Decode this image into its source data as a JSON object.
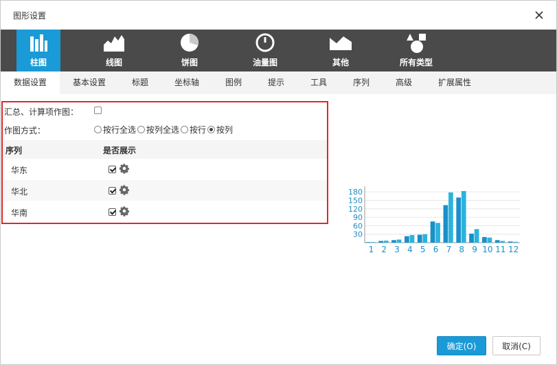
{
  "dialog": {
    "title": "图形设置",
    "close_icon": "close-icon"
  },
  "chart_types": [
    {
      "label": "柱图",
      "icon": "bar-chart-icon",
      "active": true
    },
    {
      "label": "线图",
      "icon": "line-chart-icon",
      "active": false
    },
    {
      "label": "饼图",
      "icon": "pie-chart-icon",
      "active": false
    },
    {
      "label": "油量图",
      "icon": "gauge-icon",
      "active": false
    },
    {
      "label": "其他",
      "icon": "other-chart-icon",
      "active": false
    },
    {
      "label": "所有类型",
      "icon": "all-types-icon",
      "active": false
    }
  ],
  "tabs": [
    {
      "label": "数据设置",
      "active": true
    },
    {
      "label": "基本设置"
    },
    {
      "label": "标题"
    },
    {
      "label": "坐标轴"
    },
    {
      "label": "图例"
    },
    {
      "label": "提示"
    },
    {
      "label": "工具"
    },
    {
      "label": "序列"
    },
    {
      "label": "高级"
    },
    {
      "label": "扩展属性"
    }
  ],
  "data_settings": {
    "summary_label": "汇总、计算项作图：",
    "summary_checked": false,
    "mode_label": "作图方式：",
    "modes": [
      {
        "label": "按行全选",
        "checked": false
      },
      {
        "label": "按列全选",
        "checked": false
      },
      {
        "label": "按行",
        "checked": false
      },
      {
        "label": "按列",
        "checked": true
      }
    ],
    "table": {
      "headers": [
        "序列",
        "是否展示"
      ],
      "rows": [
        {
          "name": "华东",
          "shown": true,
          "icon": "gear-icon"
        },
        {
          "name": "华北",
          "shown": true,
          "icon": "gear-icon"
        },
        {
          "name": "华南",
          "shown": true,
          "icon": "gear-icon"
        }
      ]
    }
  },
  "chart_data": {
    "type": "bar",
    "categories": [
      "1",
      "2",
      "3",
      "4",
      "5",
      "6",
      "7",
      "8",
      "9",
      "10",
      "11",
      "12"
    ],
    "series": [
      {
        "values": [
          2,
          6,
          9,
          23,
          28,
          75,
          133,
          160,
          32,
          20,
          9,
          4
        ]
      },
      {
        "values": [
          2,
          7,
          11,
          27,
          30,
          70,
          178,
          183,
          48,
          18,
          6,
          3
        ]
      }
    ],
    "yticks": [
      30,
      60,
      90,
      120,
      150,
      180
    ],
    "ylim": [
      0,
      195
    ],
    "colors": [
      "#1a8fc9",
      "#2bb3e0"
    ],
    "grid": true
  },
  "buttons": {
    "ok": "确定(O)",
    "cancel": "取消(C)"
  },
  "colors": {
    "accent": "#1a9ad6",
    "type_bar_bg": "#4a4a4a",
    "panel_border": "#e0252b"
  }
}
